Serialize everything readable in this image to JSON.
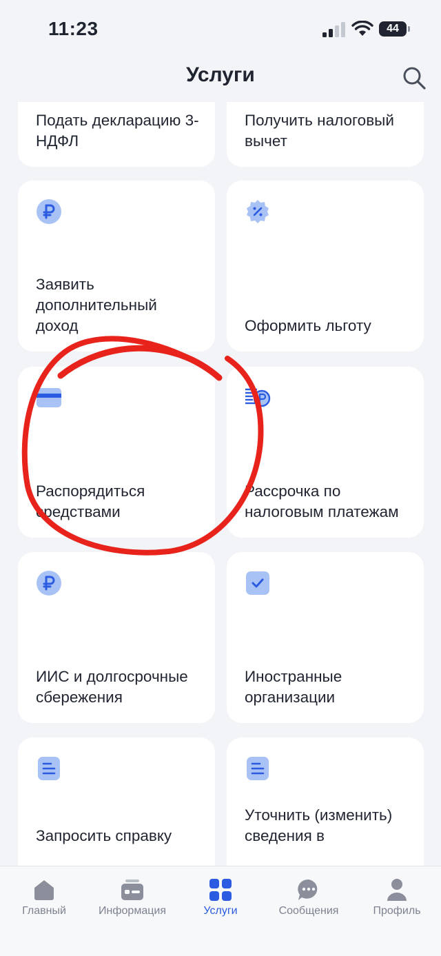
{
  "status": {
    "time": "11:23",
    "battery": "44"
  },
  "header": {
    "title": "Услуги"
  },
  "cards": [
    {
      "label": "Подать декларацию 3-НДФЛ",
      "icon": "document-icon"
    },
    {
      "label": "Получить налоговый вычет",
      "icon": "percent-icon"
    },
    {
      "label": "Заявить дополнительный доход",
      "icon": "ruble-icon"
    },
    {
      "label": "Оформить льготу",
      "icon": "percent-badge-icon"
    },
    {
      "label": "Распорядиться средствами",
      "icon": "card-icon"
    },
    {
      "label": "Рассрочка по налоговым платежам",
      "icon": "installment-icon"
    },
    {
      "label": "ИИС и долгосрочные сбережения",
      "icon": "ruble-icon"
    },
    {
      "label": "Иностранные организации",
      "icon": "checkbox-icon"
    },
    {
      "label": "Запросить справку",
      "icon": "document-icon"
    },
    {
      "label": "Уточнить (изменить) сведения в",
      "icon": "document-icon"
    }
  ],
  "tabs": [
    {
      "label": "Главный",
      "icon": "home-icon"
    },
    {
      "label": "Информация",
      "icon": "id-card-icon"
    },
    {
      "label": "Услуги",
      "icon": "grid-icon",
      "active": true
    },
    {
      "label": "Сообщения",
      "icon": "chat-icon"
    },
    {
      "label": "Профиль",
      "icon": "user-icon"
    }
  ],
  "colors": {
    "accent": "#2B5BE0",
    "icon_bg": "#A9C2F5",
    "annotation": "#E8231B"
  }
}
